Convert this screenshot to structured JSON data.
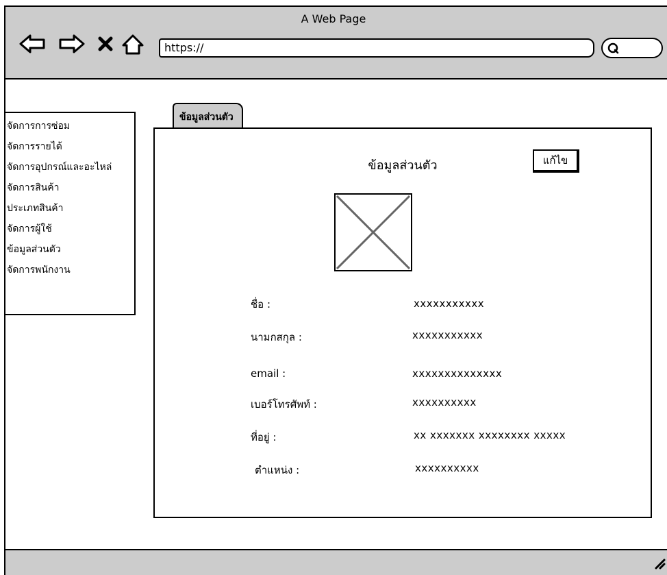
{
  "window": {
    "title": "A Web Page",
    "url": "https://"
  },
  "icons": [
    "back-arrow-icon",
    "forward-arrow-icon",
    "close-icon",
    "home-icon",
    "search-icon",
    "resize-grip-icon",
    "image-placeholder-icon"
  ],
  "sidebar": {
    "items": [
      {
        "label": "จัดการการซ่อม"
      },
      {
        "label": "จัดการรายได้"
      },
      {
        "label": "จัดการอุปกรณ์และอะไหล่"
      },
      {
        "label": "จัดการสินค้า"
      },
      {
        "label": "ประเภทสินค้า"
      },
      {
        "label": "จัดการผู้ใช้"
      },
      {
        "label": "ข้อมูลส่วนตัว"
      },
      {
        "label": "จัดการพนักงาน"
      }
    ]
  },
  "tab": {
    "label": "ข้อมูลส่วนตัว"
  },
  "panel": {
    "title": "ข้อมูลส่วนตัว",
    "edit_label": "แก้ไข",
    "fields": [
      {
        "label": "ชื่อ :",
        "value": "xxxxxxxxxxx"
      },
      {
        "label": "นามกสกุล :",
        "value": "xxxxxxxxxxx"
      },
      {
        "label": "email :",
        "value": "xxxxxxxxxxxxxx"
      },
      {
        "label": "เบอร์โทรศัพท์ :",
        "value": "xxxxxxxxxx"
      },
      {
        "label": "ที่อยู่ :",
        "value": "xx xxxxxxx xxxxxxxx xxxxx"
      },
      {
        "label": "ตำแหน่ง :",
        "value": "xxxxxxxxxx"
      }
    ]
  }
}
